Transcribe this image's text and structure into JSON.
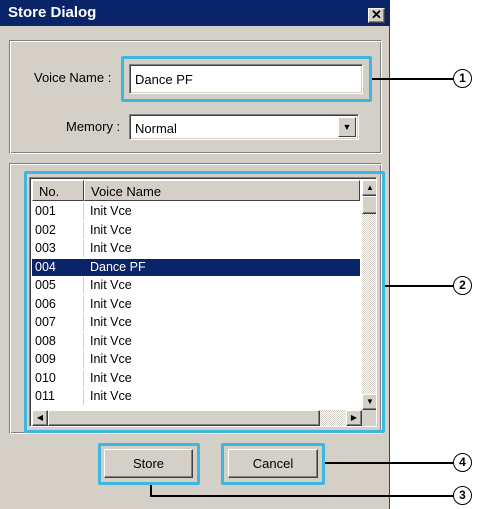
{
  "dialog": {
    "title": "Store Dialog",
    "close_label": "✕",
    "voice_name_label": "Voice Name :",
    "voice_name_value": "Dance PF",
    "memory_label": "Memory :",
    "memory_value": "Normal",
    "list": {
      "columns": [
        "No.",
        "Voice Name"
      ],
      "rows": [
        {
          "no": "001",
          "name": "Init Vce"
        },
        {
          "no": "002",
          "name": "Init Vce"
        },
        {
          "no": "003",
          "name": "Init Vce"
        },
        {
          "no": "004",
          "name": "Dance PF"
        },
        {
          "no": "005",
          "name": "Init Vce"
        },
        {
          "no": "006",
          "name": "Init Vce"
        },
        {
          "no": "007",
          "name": "Init Vce"
        },
        {
          "no": "008",
          "name": "Init Vce"
        },
        {
          "no": "009",
          "name": "Init Vce"
        },
        {
          "no": "010",
          "name": "Init Vce"
        },
        {
          "no": "011",
          "name": "Init Vce"
        }
      ],
      "selected_no": "004"
    },
    "buttons": {
      "store": "Store",
      "cancel": "Cancel"
    }
  },
  "callouts": {
    "c1": "1",
    "c2": "2",
    "c3": "3",
    "c4": "4"
  },
  "colors": {
    "highlight": "#3fb6e0",
    "titlebar": "#0a246a",
    "selection": "#0a246a"
  }
}
